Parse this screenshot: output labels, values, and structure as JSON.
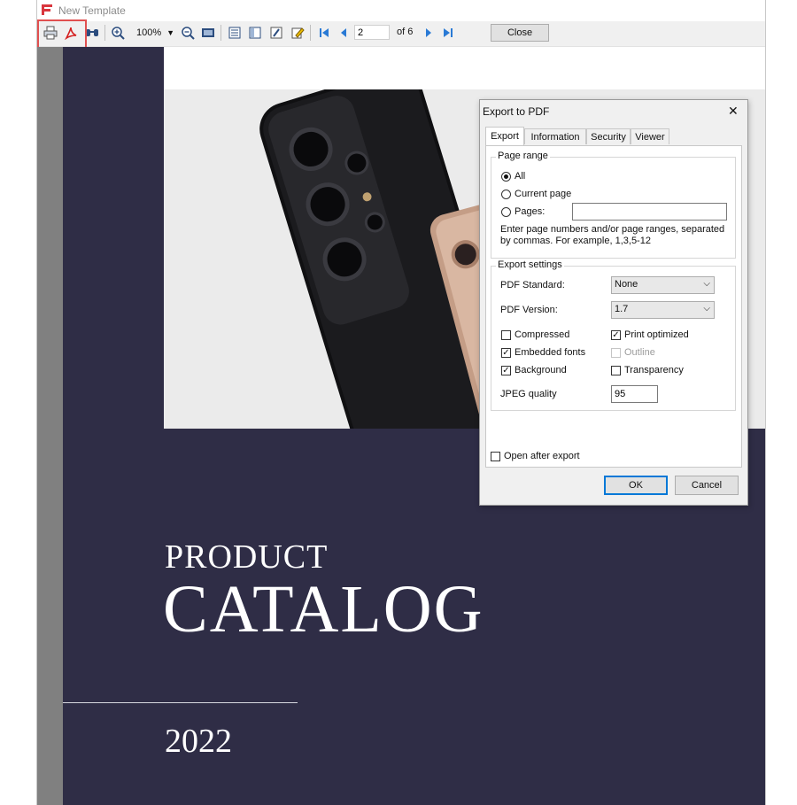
{
  "window": {
    "title": "New Template"
  },
  "toolbar": {
    "zoom_value": "100%",
    "page_current": "2",
    "page_of": "of 6",
    "close_label": "Close",
    "icons": [
      "print-icon",
      "export-pdf-icon",
      "find-icon",
      "zoom-in-icon",
      "zoom-out-icon",
      "page-view-icon",
      "outline-icon",
      "thumbnails-icon",
      "design-icon",
      "edit-icon",
      "first-page-icon",
      "prev-page-icon",
      "next-page-icon",
      "last-page-icon"
    ]
  },
  "catalog": {
    "line1": "PRODUCT",
    "line2": "CATALOG",
    "year": "2022",
    "page_bg": "#2f2d46"
  },
  "dialog": {
    "title": "Export to PDF",
    "tabs": [
      "Export",
      "Information",
      "Security",
      "Viewer"
    ],
    "active_tab": "Export",
    "page_range": {
      "label": "Page range",
      "options": [
        "All",
        "Current page",
        "Pages:"
      ],
      "selected": "All",
      "pages_value": "",
      "hint": "Enter page numbers and/or page ranges, separated by commas. For example, 1,3,5-12"
    },
    "export_settings": {
      "label": "Export settings",
      "pdf_standard_label": "PDF Standard:",
      "pdf_standard_value": "None",
      "pdf_version_label": "PDF Version:",
      "pdf_version_value": "1.7",
      "checkboxes": [
        {
          "label": "Compressed",
          "checked": false,
          "enabled": true
        },
        {
          "label": "Print optimized",
          "checked": true,
          "enabled": true
        },
        {
          "label": "Embedded fonts",
          "checked": true,
          "enabled": true
        },
        {
          "label": "Outline",
          "checked": false,
          "enabled": false
        },
        {
          "label": "Background",
          "checked": true,
          "enabled": true
        },
        {
          "label": "Transparency",
          "checked": false,
          "enabled": true
        }
      ],
      "jpeg_quality_label": "JPEG quality",
      "jpeg_quality_value": "95"
    },
    "open_after_export": {
      "label": "Open after export",
      "checked": false
    },
    "ok_label": "OK",
    "cancel_label": "Cancel"
  },
  "colors": {
    "accent": "#0078d7",
    "highlight": "#e05050",
    "pdf_red": "#d42020"
  }
}
